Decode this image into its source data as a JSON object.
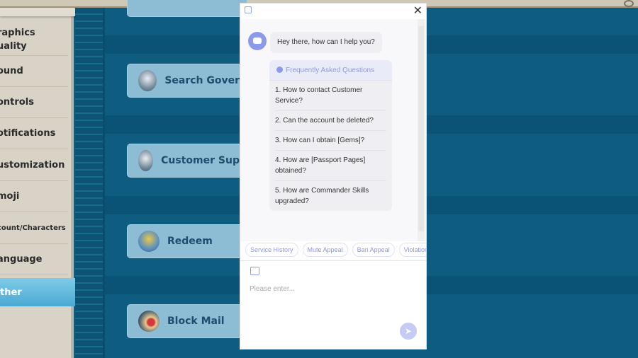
{
  "sidebar": {
    "items": [
      {
        "label": "raphics\nuality"
      },
      {
        "label": "ound"
      },
      {
        "label": "ontrols"
      },
      {
        "label": "otifications"
      },
      {
        "label": "ustomization"
      },
      {
        "label": "moji"
      },
      {
        "label": "count/Characters"
      },
      {
        "label": "anguage"
      }
    ],
    "active": "ther"
  },
  "main": {
    "buttons": [
      {
        "label": "Search Govern"
      },
      {
        "label": "Customer Supp"
      },
      {
        "label": "Redeem"
      },
      {
        "label": "Block Mail"
      }
    ]
  },
  "chat": {
    "greeting": "Hey there, how can I help you?",
    "faq_title": "Frequently Asked Questions",
    "faq": [
      "1. How to contact Customer Service?",
      "2. Can the account be deleted?",
      "3. How can I obtain [Gems]?",
      "4. How are [Passport Pages] obtained?",
      "5. How are Commander Skills upgraded?"
    ],
    "chips": [
      "Service History",
      "Mute Appeal",
      "Ban Appeal",
      "Violation R"
    ],
    "placeholder": "Please enter...",
    "close": "✕",
    "send": "➤"
  },
  "colors": {
    "accent": "#8d9ae8",
    "game_blue": "#0e5c80",
    "button": "#8dbcd5"
  }
}
